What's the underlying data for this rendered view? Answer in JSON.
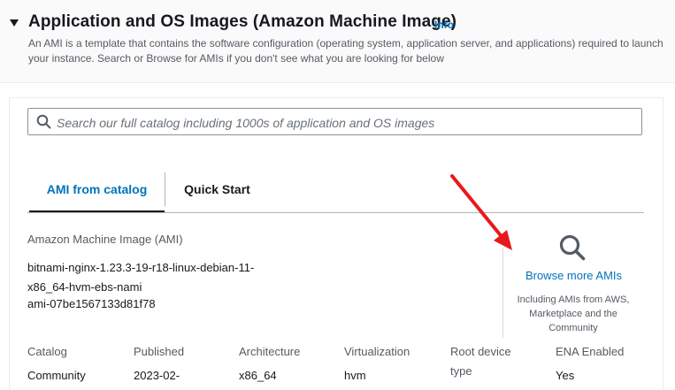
{
  "section": {
    "title": "Application and OS Images (Amazon Machine Image)",
    "info_label": "Info",
    "description": "An AMI is a template that contains the software configuration (operating system, application server, and applications) required to launch your instance. Search or Browse for AMIs if you don't see what you are looking for below"
  },
  "search": {
    "placeholder": "Search our full catalog including 1000s of application and OS images"
  },
  "tabs": [
    {
      "label": "AMI from catalog",
      "active": true
    },
    {
      "label": "Quick Start",
      "active": false
    }
  ],
  "ami": {
    "label": "Amazon Machine Image (AMI)",
    "name": "bitnami-nginx-1.23.3-19-r18-linux-debian-11-x86_64-hvm-ebs-nami",
    "id": "ami-07be1567133d81f78"
  },
  "browse": {
    "link_label": "Browse more AMIs",
    "description": "Including AMIs from AWS, Marketplace and the Community"
  },
  "details": {
    "columns": [
      {
        "header": "Catalog",
        "value": "Community"
      },
      {
        "header": "Published",
        "value": "2023-02-"
      },
      {
        "header": "Architecture",
        "value": "x86_64"
      },
      {
        "header": "Virtualization",
        "value": "hvm"
      },
      {
        "header": "Root device type",
        "value": ""
      },
      {
        "header": "ENA Enabled",
        "value": "Yes"
      }
    ]
  },
  "colors": {
    "link": "#0073bb",
    "annotation_arrow": "#e8191c",
    "text": "#16191f",
    "muted_text": "#545b64"
  },
  "icons": {
    "caret": "caret-down-icon",
    "search": "search-icon",
    "browse": "magnifier-icon",
    "annotation": "red-arrow-annotation"
  }
}
